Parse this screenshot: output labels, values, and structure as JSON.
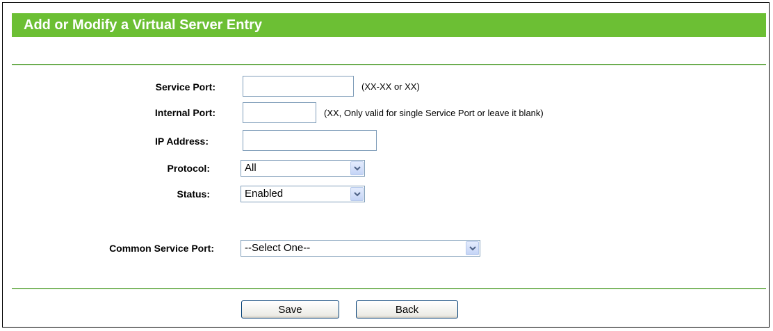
{
  "page": {
    "title": "Add or Modify a Virtual Server Entry"
  },
  "form": {
    "service_port": {
      "label": "Service Port:",
      "value": "",
      "hint": "(XX-XX or XX)"
    },
    "internal_port": {
      "label": "Internal Port:",
      "value": "",
      "hint": "(XX, Only valid for single Service Port or leave it blank)"
    },
    "ip_address": {
      "label": "IP Address:",
      "value": ""
    },
    "protocol": {
      "label": "Protocol:",
      "selected": "All"
    },
    "status": {
      "label": "Status:",
      "selected": "Enabled"
    },
    "common_service_port": {
      "label": "Common Service Port:",
      "selected": "--Select One--"
    }
  },
  "buttons": {
    "save_label": "Save",
    "back_label": "Back"
  },
  "colors": {
    "title_bar": "#6cbf34",
    "title_text": "#ffffff",
    "rule": "#4a9a2a",
    "input_border": "#7f9db9"
  },
  "icons": {
    "dropdown": "chevron-down-icon"
  }
}
